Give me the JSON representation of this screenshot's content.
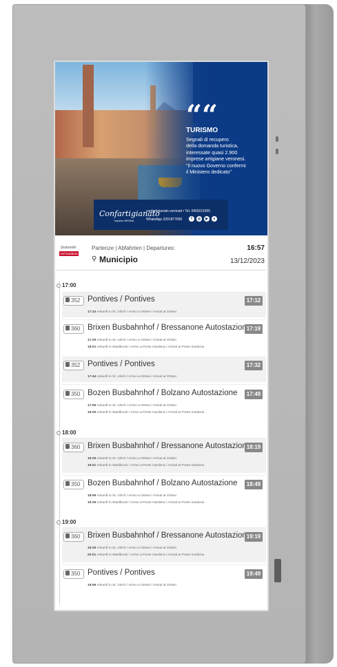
{
  "ad": {
    "quote_mark": "““",
    "title": "TURISMO",
    "body_lines": [
      "Segnali di recupero",
      "della domanda turistica,",
      "interessate quasi 2.900",
      "imprese artigiane veronesi.",
      "“Il nuovo Governo confermi",
      "il Ministero dedicato”"
    ],
    "logo": "Confartigianato",
    "logo_sub": "Imprese VERONA",
    "contact_line1": "confartigianato.veronait  •  Tel. 0459211555",
    "contact_line2": "WhatsApp 3291877665"
  },
  "header": {
    "brand_top": "Dolomiti",
    "brand_tag": "Val Gardena",
    "departures_label": "Partenze | Abfahrten | Departures:",
    "stop_name": "Municipio",
    "clock": "16:57",
    "date": "13/12/2023"
  },
  "hours": [
    "17:00",
    "18:00",
    "19:00"
  ],
  "departures": [
    {
      "line": "352",
      "dest": "Pontives / Pontives",
      "time": "17:12",
      "stops": [
        {
          "t": "17:24",
          "txt": "Ankunft in St. Ulrich / Arrivo a Ortisei / Arrival at Ortisei"
        }
      ]
    },
    {
      "line": "360",
      "dest": "Brixen Busbahnhof / Bressanone Autostazione",
      "time": "17:19",
      "stops": [
        {
          "t": "17:29",
          "txt": "Ankunft in St. Ulrich / Arrivo a Ortisei / Arrival at Ortisei"
        },
        {
          "t": "18:01",
          "txt": "Ankunft in Waidbruck / Arrivo a Ponte Gardena / Arrival at Ponte Gardena"
        }
      ]
    },
    {
      "line": "352",
      "dest": "Pontives / Pontives",
      "time": "17:32",
      "stops": [
        {
          "t": "17:44",
          "txt": "Ankunft in St. Ulrich / Arrivo a Ortisei / Arrival at Ortisei"
        }
      ]
    },
    {
      "line": "350",
      "dest": "Bozen Busbahnhof / Bolzano Autostazione",
      "time": "17:49",
      "stops": [
        {
          "t": "17:59",
          "txt": "Ankunft in St. Ulrich / Arrivo a Ortisei / Arrival at Ortisei"
        },
        {
          "t": "18:29",
          "txt": "Ankunft in Waidbruck / Arrivo a Ponte Gardena / Arrival at Ponte Gardena"
        }
      ]
    },
    {
      "line": "360",
      "dest": "Brixen Busbahnhof / Bressanone Autostazione",
      "time": "18:19",
      "stops": [
        {
          "t": "18:29",
          "txt": "Ankunft in St. Ulrich / Arrivo a Ortisei / Arrival at Ortisei"
        },
        {
          "t": "19:01",
          "txt": "Ankunft in Waidbruck / Arrivo a Ponte Gardena / Arrival at Ponte Gardena"
        }
      ]
    },
    {
      "line": "350",
      "dest": "Bozen Busbahnhof / Bolzano Autostazione",
      "time": "18:49",
      "stops": [
        {
          "t": "18:59",
          "txt": "Ankunft in St. Ulrich / Arrivo a Ortisei / Arrival at Ortisei"
        },
        {
          "t": "19:29",
          "txt": "Ankunft in Waidbruck / Arrivo a Ponte Gardena / Arrival at Ponte Gardena"
        }
      ]
    },
    {
      "line": "360",
      "dest": "Brixen Busbahnhof / Bressanone Autostazione",
      "time": "19:19",
      "stops": [
        {
          "t": "19:29",
          "txt": "Ankunft in St. Ulrich / Arrivo a Ortisei / Arrival at Ortisei"
        },
        {
          "t": "20:01",
          "txt": "Ankunft in Waidbruck / Arrivo a Ponte Gardena / Arrival at Ponte Gardena"
        }
      ]
    },
    {
      "line": "350",
      "dest": "Pontives / Pontives",
      "time": "19:49",
      "stops": [
        {
          "t": "19:59",
          "txt": "Ankunft in St. Ulrich / Arrivo a Ortisei / Arrival at Ortisei"
        }
      ]
    }
  ]
}
